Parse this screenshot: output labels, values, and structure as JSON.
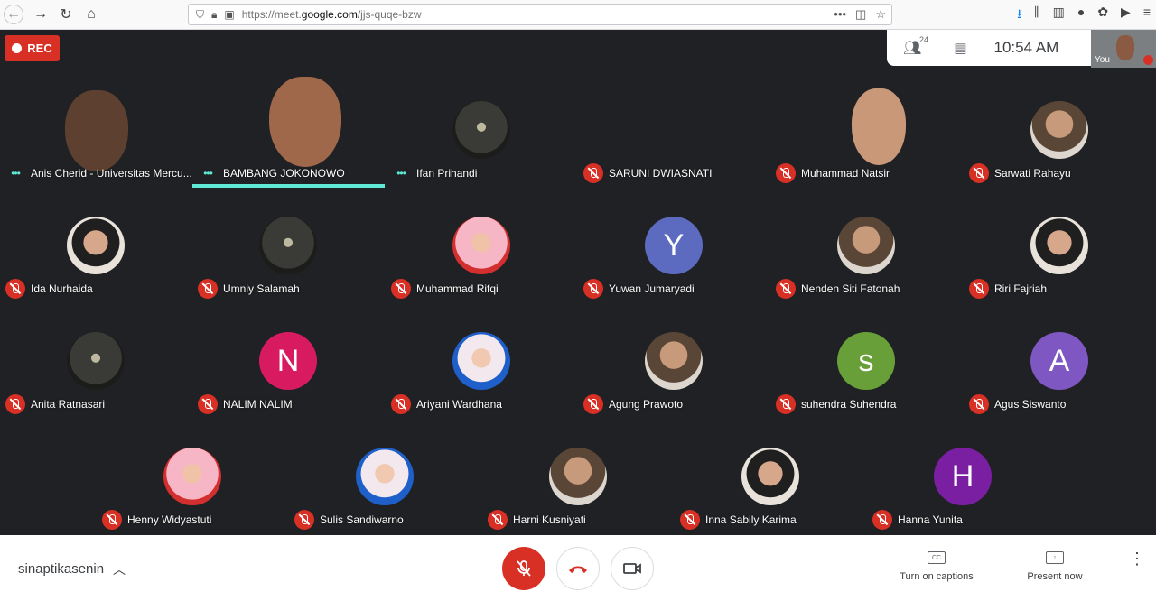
{
  "browser": {
    "url_prefix": "https://meet.",
    "url_domain": "google.com",
    "url_path": "/jjs-quqe-bzw",
    "url_more": "•••"
  },
  "meet": {
    "rec_label": "REC",
    "people_count": "24",
    "clock": "10:54  AM",
    "self_label": "You",
    "meeting_name": "sinaptikasenin",
    "captions_label": "Turn on captions",
    "captions_icon_text": "CC",
    "present_label": "Present now"
  },
  "participants": [
    {
      "name": "Anis Cherid - Universitas Mercu...",
      "state": "speaking",
      "kind": "video1"
    },
    {
      "name": "BAMBANG JOKONOWO",
      "state": "speaking",
      "kind": "video2"
    },
    {
      "name": "Ifan Prihandi",
      "state": "speaking",
      "kind": "photo"
    },
    {
      "name": "SARUNI DWIASNATI",
      "state": "muted",
      "kind": "video4"
    },
    {
      "name": "Muhammad Natsir",
      "state": "muted",
      "kind": "video5"
    },
    {
      "name": "Sarwati Rahayu",
      "state": "muted",
      "kind": "photo"
    },
    {
      "name": "Ida Nurhaida",
      "state": "muted",
      "kind": "photo"
    },
    {
      "name": "Umniy Salamah",
      "state": "muted",
      "kind": "photo"
    },
    {
      "name": "Muhammad Rifqi",
      "state": "muted",
      "kind": "photo"
    },
    {
      "name": "Yuwan Jumaryadi",
      "state": "muted",
      "kind": "letter",
      "letter": "Y",
      "color": "#5c6bc0"
    },
    {
      "name": "Nenden Siti Fatonah",
      "state": "muted",
      "kind": "photo"
    },
    {
      "name": "Riri Fajriah",
      "state": "muted",
      "kind": "photo"
    },
    {
      "name": "Anita Ratnasari",
      "state": "muted",
      "kind": "photo"
    },
    {
      "name": "NALIM NALIM",
      "state": "muted",
      "kind": "letter",
      "letter": "N",
      "color": "#d81b60"
    },
    {
      "name": "Ariyani Wardhana",
      "state": "muted",
      "kind": "photo"
    },
    {
      "name": "Agung Prawoto",
      "state": "muted",
      "kind": "photo"
    },
    {
      "name": "suhendra Suhendra",
      "state": "muted",
      "kind": "letter",
      "letter": "s",
      "color": "#689f38"
    },
    {
      "name": "Agus Siswanto",
      "state": "muted",
      "kind": "letter",
      "letter": "A",
      "color": "#7e57c2"
    },
    {
      "name": "Henny Widyastuti",
      "state": "muted",
      "kind": "photo"
    },
    {
      "name": "Sulis Sandiwarno",
      "state": "muted",
      "kind": "photo"
    },
    {
      "name": "Harni Kusniyati",
      "state": "muted",
      "kind": "photo"
    },
    {
      "name": "Inna Sabily Karima",
      "state": "muted",
      "kind": "photo"
    },
    {
      "name": "Hanna Yunita",
      "state": "muted",
      "kind": "letter",
      "letter": "H",
      "color": "#7b1fa2"
    }
  ],
  "colors": {
    "accent_red": "#d93025",
    "speaking": "#5eead4",
    "background": "#202124"
  }
}
